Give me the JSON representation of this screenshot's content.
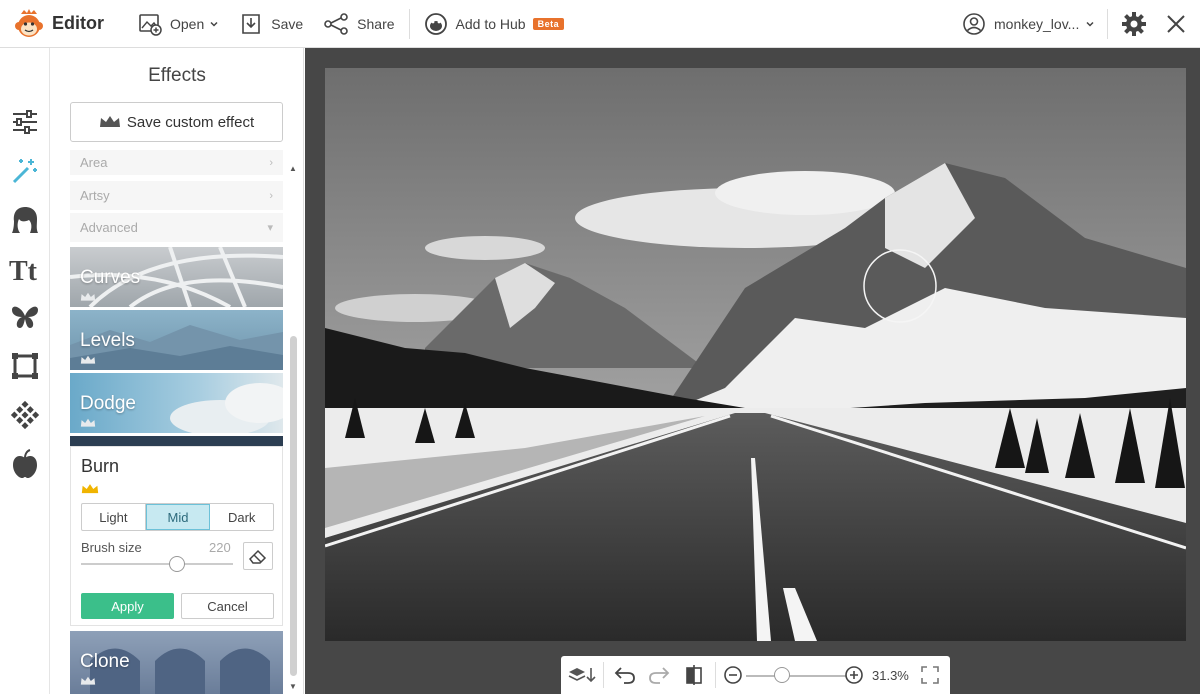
{
  "app": {
    "name": "Editor"
  },
  "toolbar": {
    "open_label": "Open",
    "save_label": "Save",
    "share_label": "Share",
    "hub_label": "Add to Hub",
    "beta_badge": "Beta",
    "username": "monkey_lov..."
  },
  "panel": {
    "title": "Effects",
    "save_custom_label": "Save custom effect",
    "categories": [
      {
        "label": "Area"
      },
      {
        "label": "Artsy"
      },
      {
        "label": "Advanced"
      }
    ],
    "tiles": [
      {
        "label": "Curves"
      },
      {
        "label": "Levels"
      },
      {
        "label": "Dodge"
      },
      {
        "label": "Clone"
      }
    ],
    "burn": {
      "title": "Burn",
      "modes": [
        "Light",
        "Mid",
        "Dark"
      ],
      "selected_mode": "Mid",
      "brush_size_label": "Brush size",
      "brush_size_value": "220",
      "apply_label": "Apply",
      "cancel_label": "Cancel"
    }
  },
  "bottom_toolbar": {
    "zoom": "31.3%"
  },
  "colors": {
    "accent_green": "#3bbf8a",
    "beta_orange": "#e8722c",
    "workspace": "#474747"
  }
}
